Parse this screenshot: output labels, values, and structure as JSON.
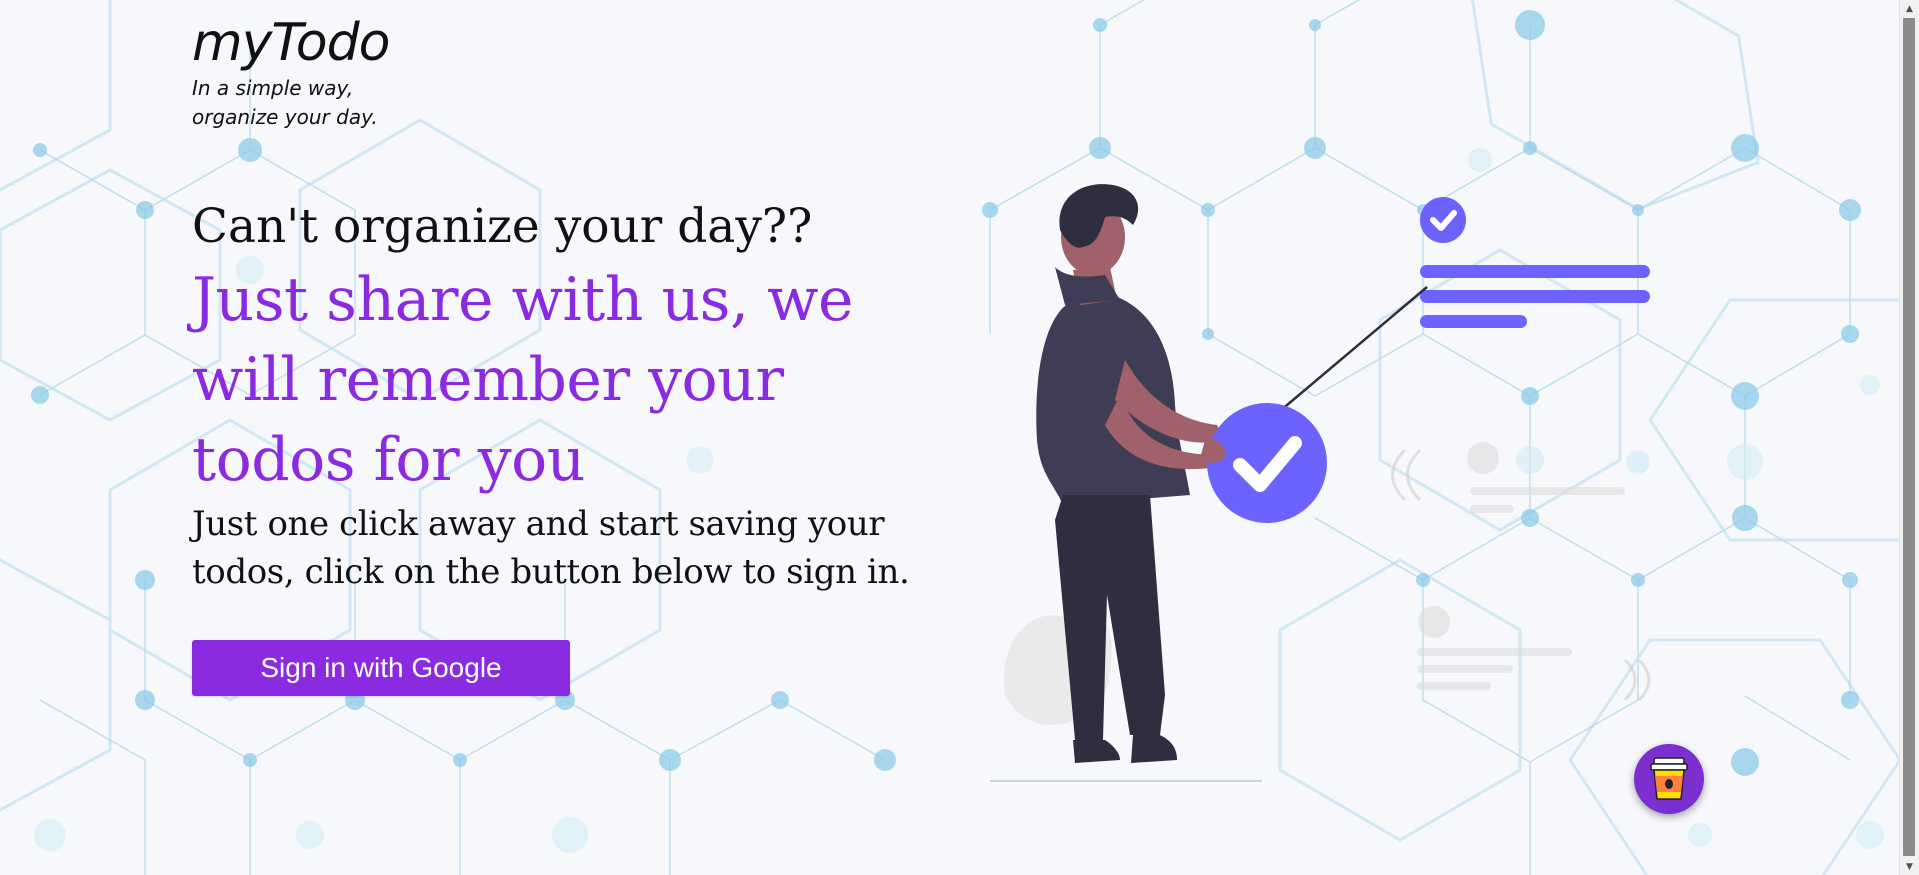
{
  "brand": {
    "title": "myTodo",
    "tagline": "In a simple way, organize your day."
  },
  "hero": {
    "question": "Can't organize your day??",
    "headline": "Just share with us, we will remember your todos for you",
    "subtext": "Just one click away and start saving your todos, click on the button below to sign in."
  },
  "auth": {
    "signin_label": "Sign in with Google"
  },
  "colors": {
    "accent": "#8a2be2",
    "illustration_accent": "#6c63ff",
    "coffee_button": "#7b2fce"
  },
  "icons": {
    "coffee": "coffee-cup-icon",
    "check": "check-circle-icon"
  }
}
